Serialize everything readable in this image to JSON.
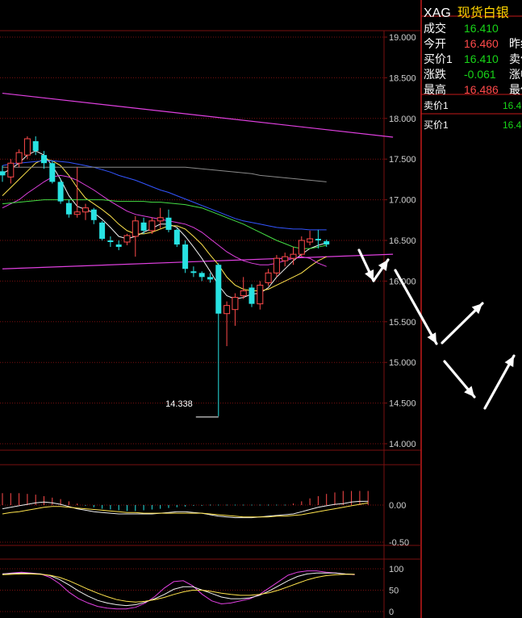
{
  "quote": {
    "symbol": "XAG",
    "name": "现货白银",
    "rows": [
      {
        "label": "成交",
        "value": "16.410",
        "color": "#18d518",
        "label2": ""
      },
      {
        "label": "今开",
        "value": "16.460",
        "color": "#ff4a4a",
        "label2": "昨结"
      },
      {
        "label": "买价1",
        "value": "16.410",
        "color": "#18d518",
        "label2": "卖价"
      },
      {
        "label": "涨跌",
        "value": "-0.061",
        "color": "#18d518",
        "label2": "涨幅"
      },
      {
        "label": "最高",
        "value": "16.486",
        "color": "#ff4a4a",
        "label2": "最低"
      }
    ],
    "orderbook": [
      {
        "label": "卖价1",
        "value": "16.4"
      },
      {
        "label": "买价1",
        "value": "16.4"
      }
    ]
  },
  "colors": {
    "up": "#ff4a4a",
    "down": "#28e2e2",
    "grid": "#7a1010",
    "axis_label": "#cfcfcf",
    "ma_white": "#f0f0f0",
    "ma_yellow": "#ffe44d",
    "ma_magenta": "#e040e0",
    "ma_green": "#44dd44",
    "ma_blue": "#3355ff",
    "ma_gray": "#8a8a8a",
    "arrow": "#ffffff"
  },
  "chart_data": [
    {
      "type": "candlestick",
      "title": "",
      "ylim": [
        14.0,
        19.0
      ],
      "yticks": [
        "19.000",
        "18.500",
        "18.000",
        "17.500",
        "17.000",
        "16.500",
        "16.000",
        "15.500",
        "15.000",
        "14.500",
        "14.000"
      ],
      "min_label": "14.338",
      "candles": [
        {
          "o": 17.35,
          "h": 17.42,
          "l": 17.22,
          "c": 17.3
        },
        {
          "o": 17.28,
          "h": 17.5,
          "l": 17.2,
          "c": 17.45
        },
        {
          "o": 17.45,
          "h": 17.62,
          "l": 17.4,
          "c": 17.58
        },
        {
          "o": 17.55,
          "h": 17.78,
          "l": 17.5,
          "c": 17.75
        },
        {
          "o": 17.72,
          "h": 17.78,
          "l": 17.55,
          "c": 17.6
        },
        {
          "o": 17.55,
          "h": 17.6,
          "l": 17.38,
          "c": 17.45
        },
        {
          "o": 17.45,
          "h": 17.48,
          "l": 17.2,
          "c": 17.22
        },
        {
          "o": 17.22,
          "h": 17.25,
          "l": 16.95,
          "c": 16.98
        },
        {
          "o": 16.96,
          "h": 17.0,
          "l": 16.78,
          "c": 16.82
        },
        {
          "o": 16.82,
          "h": 17.4,
          "l": 16.78,
          "c": 16.85
        },
        {
          "o": 16.85,
          "h": 16.95,
          "l": 16.75,
          "c": 16.9
        },
        {
          "o": 16.88,
          "h": 16.9,
          "l": 16.7,
          "c": 16.75
        },
        {
          "o": 16.72,
          "h": 16.74,
          "l": 16.5,
          "c": 16.52
        },
        {
          "o": 16.5,
          "h": 16.55,
          "l": 16.42,
          "c": 16.48
        },
        {
          "o": 16.45,
          "h": 16.5,
          "l": 16.38,
          "c": 16.42
        },
        {
          "o": 16.48,
          "h": 16.58,
          "l": 16.44,
          "c": 16.56
        },
        {
          "o": 16.55,
          "h": 16.8,
          "l": 16.3,
          "c": 16.74
        },
        {
          "o": 16.72,
          "h": 16.78,
          "l": 16.58,
          "c": 16.62
        },
        {
          "o": 16.62,
          "h": 16.78,
          "l": 16.58,
          "c": 16.74
        },
        {
          "o": 16.74,
          "h": 16.9,
          "l": 16.65,
          "c": 16.78
        },
        {
          "o": 16.78,
          "h": 16.88,
          "l": 16.6,
          "c": 16.63
        },
        {
          "o": 16.63,
          "h": 16.65,
          "l": 16.42,
          "c": 16.45
        },
        {
          "o": 16.45,
          "h": 16.5,
          "l": 16.1,
          "c": 16.15
        },
        {
          "o": 16.12,
          "h": 16.18,
          "l": 16.05,
          "c": 16.1
        },
        {
          "o": 16.1,
          "h": 16.12,
          "l": 16.0,
          "c": 16.05
        },
        {
          "o": 16.05,
          "h": 16.1,
          "l": 15.98,
          "c": 16.02
        },
        {
          "o": 16.2,
          "h": 16.22,
          "l": 14.338,
          "c": 15.6
        },
        {
          "o": 15.6,
          "h": 15.75,
          "l": 15.2,
          "c": 15.7
        },
        {
          "o": 15.65,
          "h": 15.85,
          "l": 15.45,
          "c": 15.8
        },
        {
          "o": 15.82,
          "h": 16.05,
          "l": 15.78,
          "c": 15.88
        },
        {
          "o": 15.92,
          "h": 15.96,
          "l": 15.68,
          "c": 15.72
        },
        {
          "o": 15.72,
          "h": 16.0,
          "l": 15.65,
          "c": 15.95
        },
        {
          "o": 15.98,
          "h": 16.15,
          "l": 15.94,
          "c": 16.1
        },
        {
          "o": 16.1,
          "h": 16.32,
          "l": 16.05,
          "c": 16.28
        },
        {
          "o": 16.25,
          "h": 16.35,
          "l": 16.18,
          "c": 16.3
        },
        {
          "o": 16.28,
          "h": 16.42,
          "l": 16.2,
          "c": 16.33
        },
        {
          "o": 16.33,
          "h": 16.55,
          "l": 16.3,
          "c": 16.5
        },
        {
          "o": 16.48,
          "h": 16.62,
          "l": 16.44,
          "c": 16.52
        },
        {
          "o": 16.52,
          "h": 16.63,
          "l": 16.4,
          "c": 16.5
        },
        {
          "o": 16.49,
          "h": 16.51,
          "l": 16.42,
          "c": 16.45
        }
      ],
      "ma_lines": [
        {
          "color_key": "ma_white",
          "values": [
            17.32,
            17.38,
            17.45,
            17.55,
            17.6,
            17.55,
            17.42,
            17.25,
            17.05,
            16.92,
            16.88,
            16.84,
            16.76,
            16.66,
            16.55,
            16.52,
            16.55,
            16.6,
            16.65,
            16.7,
            16.7,
            16.66,
            16.55,
            16.42,
            16.28,
            16.12,
            15.95,
            15.82,
            15.78,
            15.8,
            15.84,
            15.85,
            15.92,
            16.05,
            16.15,
            16.25,
            16.33,
            16.4,
            16.44,
            16.47
          ]
        },
        {
          "color_key": "ma_yellow",
          "values": [
            17.05,
            17.15,
            17.25,
            17.35,
            17.45,
            17.5,
            17.48,
            17.42,
            17.3,
            17.15,
            17.02,
            16.95,
            16.88,
            16.8,
            16.7,
            16.62,
            16.58,
            16.58,
            16.6,
            16.64,
            16.68,
            16.68,
            16.64,
            16.55,
            16.45,
            16.32,
            16.2,
            16.05,
            15.95,
            15.9,
            15.88,
            15.88,
            15.9,
            15.95,
            16.0,
            16.05,
            16.1,
            16.18,
            16.25,
            16.3
          ]
        },
        {
          "color_key": "ma_magenta",
          "values": [
            16.9,
            16.95,
            17.0,
            17.08,
            17.15,
            17.22,
            17.28,
            17.3,
            17.28,
            17.24,
            17.18,
            17.12,
            17.05,
            16.98,
            16.92,
            16.86,
            16.82,
            16.8,
            16.78,
            16.76,
            16.74,
            16.72,
            16.7,
            16.66,
            16.6,
            16.52,
            16.44,
            16.36,
            16.3,
            16.25,
            16.22,
            16.2,
            16.2,
            16.22,
            16.25,
            16.28,
            16.3,
            16.28,
            16.22,
            16.18
          ]
        },
        {
          "color_key": "ma_green",
          "values": [
            16.95,
            16.96,
            16.97,
            16.98,
            16.99,
            17.0,
            17.0,
            17.0,
            17.0,
            17.0,
            17.0,
            17.0,
            17.0,
            16.99,
            16.98,
            16.98,
            16.98,
            16.98,
            16.97,
            16.97,
            16.96,
            16.95,
            16.94,
            16.92,
            16.9,
            16.86,
            16.82,
            16.78,
            16.74,
            16.7,
            16.65,
            16.6,
            16.55,
            16.5,
            16.46,
            16.42,
            16.4,
            16.4,
            16.42,
            16.44
          ]
        },
        {
          "color_key": "ma_blue",
          "values": [
            17.42,
            17.44,
            17.45,
            17.46,
            17.47,
            17.48,
            17.48,
            17.47,
            17.46,
            17.44,
            17.42,
            17.4,
            17.37,
            17.34,
            17.3,
            17.27,
            17.24,
            17.2,
            17.16,
            17.12,
            17.09,
            17.05,
            17.01,
            16.97,
            16.93,
            16.89,
            16.85,
            16.81,
            16.77,
            16.74,
            16.72,
            16.7,
            16.68,
            16.66,
            16.65,
            16.64,
            16.64,
            16.63,
            16.63,
            16.63
          ]
        },
        {
          "color_key": "ma_gray",
          "values": [
            17.4,
            17.4,
            17.4,
            17.4,
            17.4,
            17.4,
            17.4,
            17.4,
            17.4,
            17.4,
            17.4,
            17.4,
            17.4,
            17.4,
            17.4,
            17.4,
            17.4,
            17.4,
            17.4,
            17.4,
            17.4,
            17.4,
            17.4,
            17.39,
            17.38,
            17.37,
            17.36,
            17.35,
            17.34,
            17.33,
            17.32,
            17.3,
            17.29,
            17.28,
            17.27,
            17.26,
            17.25,
            17.24,
            17.23,
            17.22
          ]
        }
      ],
      "trend_lines": [
        {
          "color_key": "ma_magenta",
          "from": [
            0,
            18.31
          ],
          "to": [
            47,
            17.77
          ]
        },
        {
          "color_key": "ma_magenta",
          "from": [
            0,
            16.15
          ],
          "to": [
            47,
            16.33
          ]
        }
      ]
    },
    {
      "type": "bar",
      "title": "",
      "ylim": [
        -0.5,
        0.5
      ],
      "yticks": [
        "0.00",
        "-0.50"
      ],
      "values": [
        0.16,
        0.16,
        0.16,
        0.15,
        0.14,
        0.12,
        0.1,
        0.08,
        0.05,
        0.02,
        -0.01,
        -0.03,
        -0.05,
        -0.06,
        -0.07,
        -0.08,
        -0.08,
        -0.07,
        -0.06,
        -0.05,
        -0.04,
        -0.03,
        -0.02,
        -0.01,
        -0.01,
        0.0,
        0.0,
        0.0,
        0.0,
        0.0,
        0.0,
        0.0,
        0.0,
        0.0,
        0.0,
        0.02,
        0.05,
        0.09,
        0.12,
        0.15,
        0.17,
        0.19,
        0.19,
        0.19,
        0.19
      ],
      "series": [
        {
          "name": "",
          "color_key": "ma_white",
          "values": [
            -0.05,
            -0.03,
            -0.01,
            0.01,
            0.03,
            0.04,
            0.03,
            0.01,
            -0.02,
            -0.05,
            -0.07,
            -0.09,
            -0.1,
            -0.11,
            -0.12,
            -0.12,
            -0.12,
            -0.12,
            -0.12,
            -0.11,
            -0.1,
            -0.09,
            -0.09,
            -0.1,
            -0.11,
            -0.13,
            -0.15,
            -0.16,
            -0.17,
            -0.17,
            -0.17,
            -0.16,
            -0.15,
            -0.14,
            -0.13,
            -0.12,
            -0.09,
            -0.06,
            -0.03,
            -0.01,
            0.01,
            0.02,
            0.04,
            0.05,
            0.05
          ]
        },
        {
          "name": "",
          "color_key": "ma_yellow",
          "values": [
            -0.12,
            -0.1,
            -0.09,
            -0.07,
            -0.05,
            -0.03,
            -0.02,
            -0.02,
            -0.03,
            -0.04,
            -0.05,
            -0.06,
            -0.07,
            -0.08,
            -0.09,
            -0.1,
            -0.1,
            -0.11,
            -0.11,
            -0.11,
            -0.11,
            -0.11,
            -0.11,
            -0.11,
            -0.11,
            -0.12,
            -0.13,
            -0.14,
            -0.15,
            -0.16,
            -0.16,
            -0.16,
            -0.16,
            -0.15,
            -0.15,
            -0.14,
            -0.13,
            -0.11,
            -0.09,
            -0.07,
            -0.05,
            -0.03,
            -0.01,
            0.01,
            0.03
          ]
        }
      ]
    },
    {
      "type": "line",
      "title": "",
      "ylim": [
        0,
        100
      ],
      "yticks": [
        "100",
        "50",
        "0"
      ],
      "series": [
        {
          "name": "",
          "color_key": "ma_magenta",
          "values": [
            88,
            90,
            92,
            90,
            88,
            80,
            65,
            45,
            30,
            20,
            12,
            8,
            6,
            6,
            10,
            20,
            35,
            55,
            70,
            72,
            60,
            40,
            25,
            18,
            20,
            25,
            30,
            40,
            55,
            70,
            85,
            92,
            95,
            95,
            92,
            90,
            88,
            86
          ]
        },
        {
          "name": "",
          "color_key": "ma_white",
          "values": [
            88,
            89,
            90,
            89,
            88,
            84,
            75,
            62,
            48,
            36,
            26,
            20,
            16,
            14,
            16,
            22,
            30,
            40,
            52,
            58,
            58,
            50,
            42,
            34,
            30,
            30,
            32,
            38,
            48,
            60,
            72,
            82,
            88,
            90,
            90,
            90,
            88,
            87
          ]
        },
        {
          "name": "",
          "color_key": "ma_yellow",
          "values": [
            86,
            87,
            88,
            88,
            87,
            85,
            80,
            72,
            62,
            52,
            43,
            35,
            28,
            24,
            22,
            24,
            28,
            33,
            40,
            46,
            50,
            50,
            47,
            43,
            40,
            38,
            38,
            40,
            44,
            50,
            58,
            66,
            74,
            80,
            84,
            86,
            87,
            87
          ]
        }
      ]
    }
  ]
}
